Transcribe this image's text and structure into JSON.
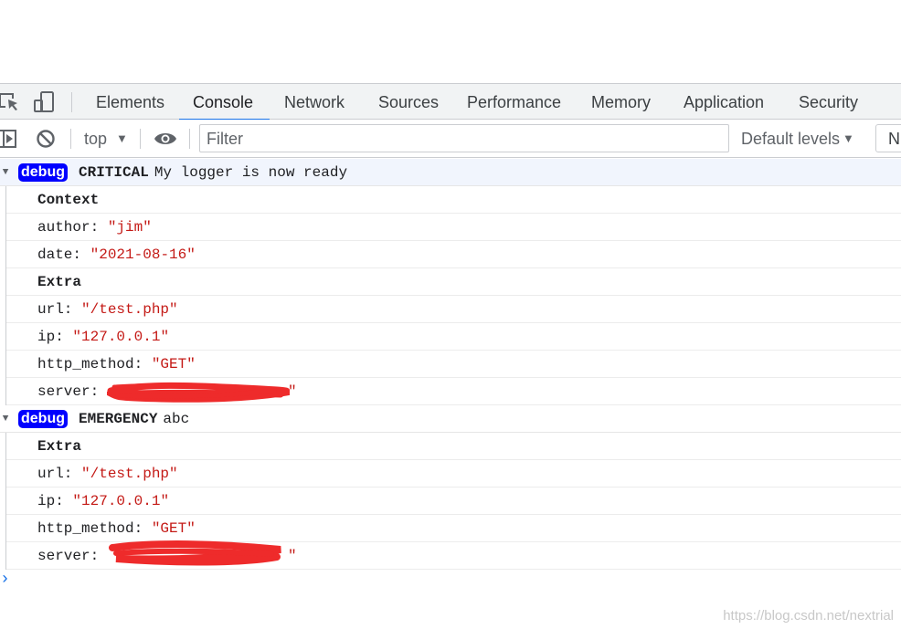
{
  "tabs": [
    {
      "label": "Elements"
    },
    {
      "label": "Console"
    },
    {
      "label": "Network"
    },
    {
      "label": "Sources"
    },
    {
      "label": "Performance"
    },
    {
      "label": "Memory"
    },
    {
      "label": "Application"
    },
    {
      "label": "Security"
    }
  ],
  "toolbar": {
    "context": "top",
    "filter_placeholder": "Filter",
    "levels": "Default levels",
    "button_partial": "N"
  },
  "logs": [
    {
      "badge": "debug",
      "level": "CRITICAL",
      "message": "My logger is now ready",
      "sections": [
        {
          "title": "Context",
          "entries": [
            {
              "key": "author:",
              "value": "\"jim\""
            },
            {
              "key": "date:",
              "value": "\"2021-08-16\""
            }
          ]
        },
        {
          "title": "Extra",
          "entries": [
            {
              "key": "url:",
              "value": "\"/test.php\""
            },
            {
              "key": "ip:",
              "value": "\"127.0.0.1\""
            },
            {
              "key": "http_method:",
              "value": "\"GET\""
            },
            {
              "key": "server:",
              "value": "\""
            }
          ]
        }
      ]
    },
    {
      "badge": "debug",
      "level": "EMERGENCY",
      "message": "abc",
      "sections": [
        {
          "title": "Extra",
          "entries": [
            {
              "key": "url:",
              "value": "\"/test.php\""
            },
            {
              "key": "ip:",
              "value": "\"127.0.0.1\""
            },
            {
              "key": "http_method:",
              "value": "\"GET\""
            },
            {
              "key": "server:",
              "value": "\""
            }
          ]
        }
      ]
    }
  ],
  "watermark": "https://blog.csdn.net/nextrial",
  "colors": {
    "accent": "#1a73e8",
    "badge": "#0000ff",
    "string": "#c41a16",
    "redaction": "#ee2b2b"
  }
}
